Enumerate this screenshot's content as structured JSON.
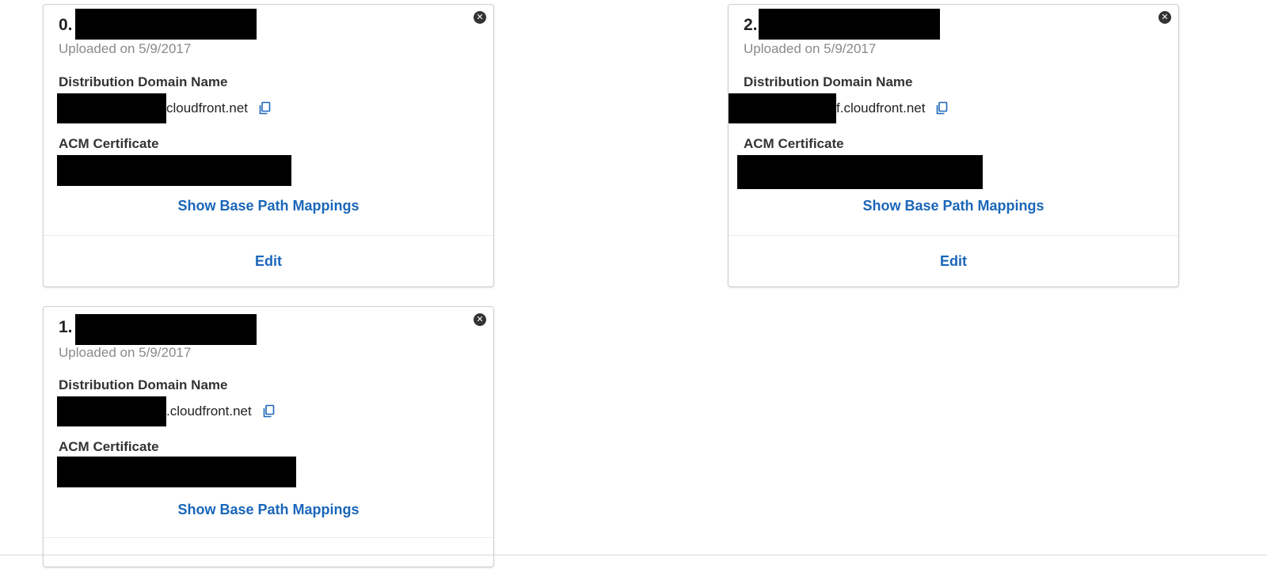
{
  "cards": [
    {
      "index_prefix": "0.",
      "uploaded": "Uploaded on 5/9/2017",
      "domain_label": "Distribution Domain Name",
      "domain_suffix": "cloudfront.net",
      "cert_label": "ACM Certificate",
      "show_mappings": "Show Base Path Mappings",
      "edit": "Edit",
      "close_glyph": "✕"
    },
    {
      "index_prefix": "2.",
      "uploaded": "Uploaded on 5/9/2017",
      "domain_label": "Distribution Domain Name",
      "domain_suffix": "f.cloudfront.net",
      "cert_label": "ACM Certificate",
      "show_mappings": "Show Base Path Mappings",
      "edit": "Edit",
      "close_glyph": "✕"
    },
    {
      "index_prefix": "1.",
      "uploaded": "Uploaded on 5/9/2017",
      "domain_label": "Distribution Domain Name",
      "domain_suffix": ".cloudfront.net",
      "cert_label": "ACM Certificate",
      "show_mappings": "Show Base Path Mappings",
      "close_glyph": "✕"
    }
  ],
  "icons": {
    "close": "close-icon",
    "copy": "copy-icon"
  },
  "colors": {
    "link": "#1a66b9",
    "redaction": "#000000",
    "muted_text": "#8a8a8a"
  }
}
